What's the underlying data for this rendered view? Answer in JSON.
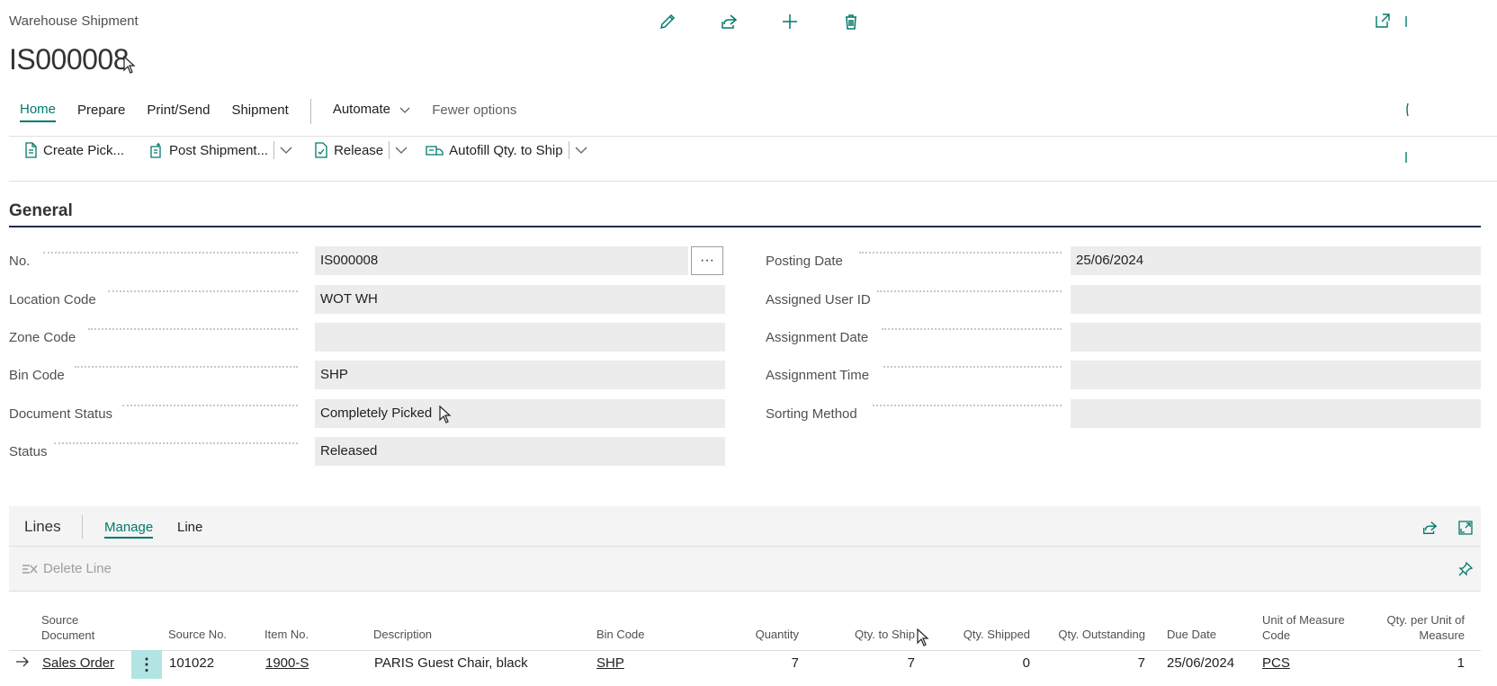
{
  "header": {
    "caption": "Warehouse Shipment",
    "title": "IS000008"
  },
  "nav": {
    "tabs": [
      "Home",
      "Prepare",
      "Print/Send",
      "Shipment"
    ],
    "automate": "Automate",
    "fewer": "Fewer options"
  },
  "actions": {
    "create_pick": "Create Pick...",
    "post_shipment": "Post Shipment...",
    "release": "Release",
    "autofill": "Autofill Qty. to Ship"
  },
  "general": {
    "title": "General",
    "left": [
      {
        "label": "No.",
        "value": "IS000008"
      },
      {
        "label": "Location Code",
        "value": "WOT WH"
      },
      {
        "label": "Zone Code",
        "value": ""
      },
      {
        "label": "Bin Code",
        "value": "SHP"
      },
      {
        "label": "Document Status",
        "value": "Completely Picked"
      },
      {
        "label": "Status",
        "value": "Released"
      }
    ],
    "right": [
      {
        "label": "Posting Date",
        "value": "25/06/2024"
      },
      {
        "label": "Assigned User ID",
        "value": ""
      },
      {
        "label": "Assignment Date",
        "value": ""
      },
      {
        "label": "Assignment Time",
        "value": ""
      },
      {
        "label": "Sorting Method",
        "value": ""
      }
    ],
    "more_glyph": "···"
  },
  "lines": {
    "title": "Lines",
    "tabs": [
      "Manage",
      "Line"
    ],
    "delete_line": "Delete Line",
    "columns": {
      "source_document": "Source Document",
      "source_no": "Source No.",
      "item_no": "Item No.",
      "description": "Description",
      "bin_code": "Bin Code",
      "quantity": "Quantity",
      "qty_to_ship": "Qty. to Ship",
      "qty_shipped": "Qty. Shipped",
      "qty_outstanding": "Qty. Outstanding",
      "due_date": "Due Date",
      "uom_code": "Unit of Measure Code",
      "qty_per_uom": "Qty. per Unit of Measure"
    },
    "rows": [
      {
        "source_document": "Sales Order",
        "source_no": "101022",
        "item_no": "1900-S",
        "description": "PARIS Guest Chair, black",
        "bin_code": "SHP",
        "quantity": "7",
        "qty_to_ship": "7",
        "qty_shipped": "0",
        "qty_outstanding": "7",
        "due_date": "25/06/2024",
        "uom_code": "PCS",
        "qty_per_uom": "1"
      }
    ]
  },
  "colors": {
    "accent": "#00796b",
    "section_rule": "#1c2d4a",
    "field_bg": "#ececec",
    "row_menu_bg": "#b2e4e4"
  }
}
